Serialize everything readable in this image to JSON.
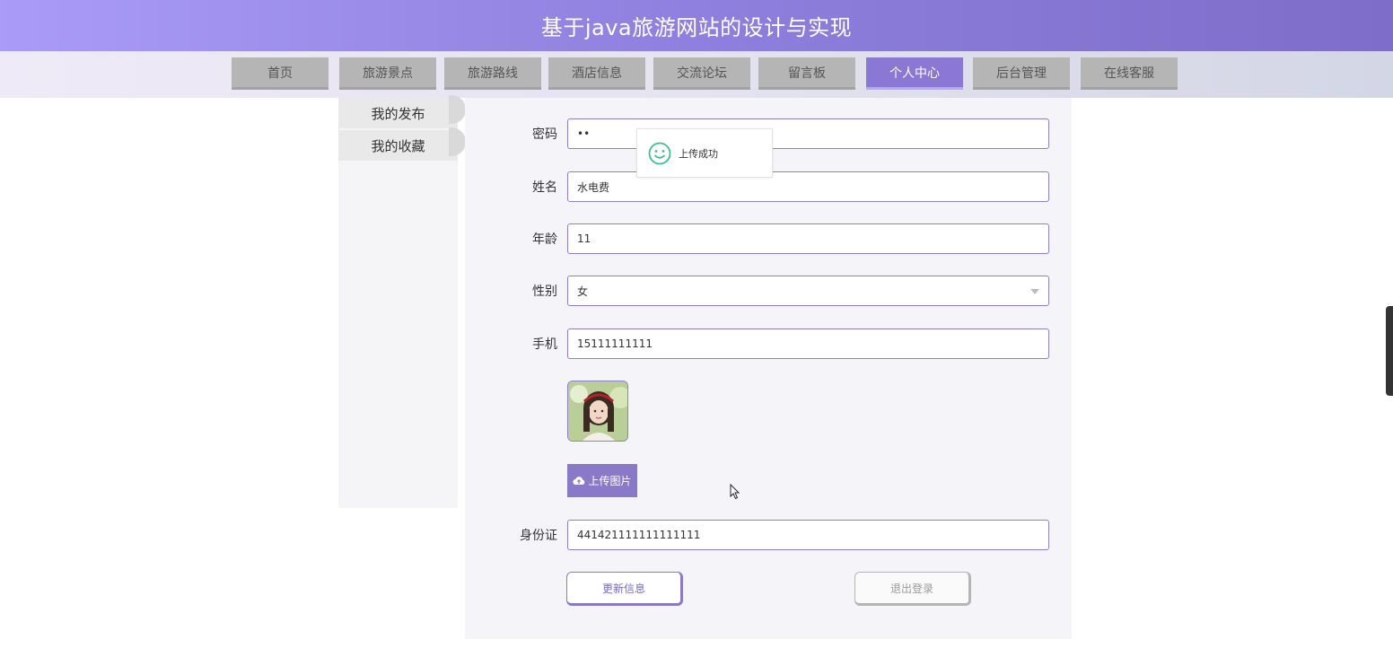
{
  "header": {
    "title": "基于java旅游网站的设计与实现"
  },
  "nav": {
    "items": [
      {
        "label": "首页"
      },
      {
        "label": "旅游景点"
      },
      {
        "label": "旅游路线"
      },
      {
        "label": "酒店信息"
      },
      {
        "label": "交流论坛"
      },
      {
        "label": "留言板"
      },
      {
        "label": "个人中心",
        "active": true
      },
      {
        "label": "后台管理"
      },
      {
        "label": "在线客服"
      }
    ],
    "active_color": "#8a78d4",
    "inactive_color": "#b5b5b5"
  },
  "sidebar": {
    "items": [
      {
        "label": "我的发布"
      },
      {
        "label": "我的收藏"
      }
    ]
  },
  "form": {
    "password": {
      "label": "密码",
      "value": "••"
    },
    "name": {
      "label": "姓名",
      "value": "水电费"
    },
    "age": {
      "label": "年龄",
      "value": "11"
    },
    "gender": {
      "label": "性别",
      "value": "女"
    },
    "phone": {
      "label": "手机",
      "value": "15111111111"
    },
    "upload_button": "上传图片",
    "id_card": {
      "label": "身份证",
      "value": "441421111111111111"
    },
    "update_button": "更新信息",
    "logout_button": "退出登录"
  },
  "toast": {
    "message": "上传成功",
    "icon": "smile-icon"
  },
  "colors": {
    "accent": "#8a78c9",
    "header_gradient_start": "#a99bf7",
    "header_gradient_end": "#7e6ec9",
    "toast_icon": "#3cc18b"
  }
}
